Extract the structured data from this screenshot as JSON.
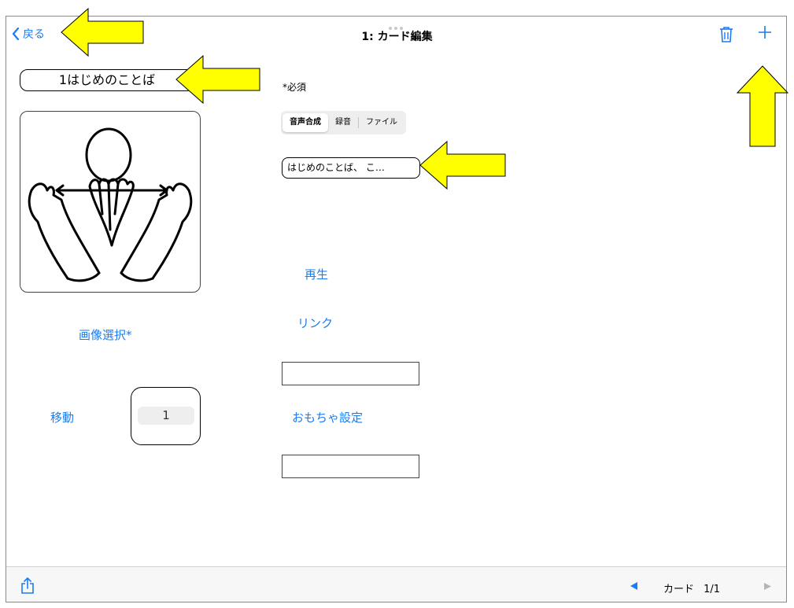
{
  "nav": {
    "back_label": "戻る",
    "title": "1: カード編集"
  },
  "card": {
    "title_value": "1はじめのことば"
  },
  "image_select_label": "画像選択*",
  "move": {
    "label": "移動",
    "value": "1"
  },
  "required_note": "*必須",
  "audio_segments": {
    "items": [
      "音声合成",
      "録音",
      "ファイル"
    ],
    "selected": "音声合成"
  },
  "speech_text_value": "はじめのことば、 こ…",
  "play_label": "再生",
  "link_label": "リンク",
  "toy_settings_label": "おもちゃ設定",
  "bottom_bar": {
    "card_label": "カード",
    "card_position": "1/1"
  },
  "colors": {
    "accent": "#1a7cf2",
    "annotation_arrow": "#ffff00"
  },
  "icons": {
    "back": "chevron-left-icon",
    "trash": "trash-icon",
    "add": "plus-icon",
    "share": "share-icon",
    "prev": "triangle-left-icon",
    "next": "triangle-right-icon"
  }
}
